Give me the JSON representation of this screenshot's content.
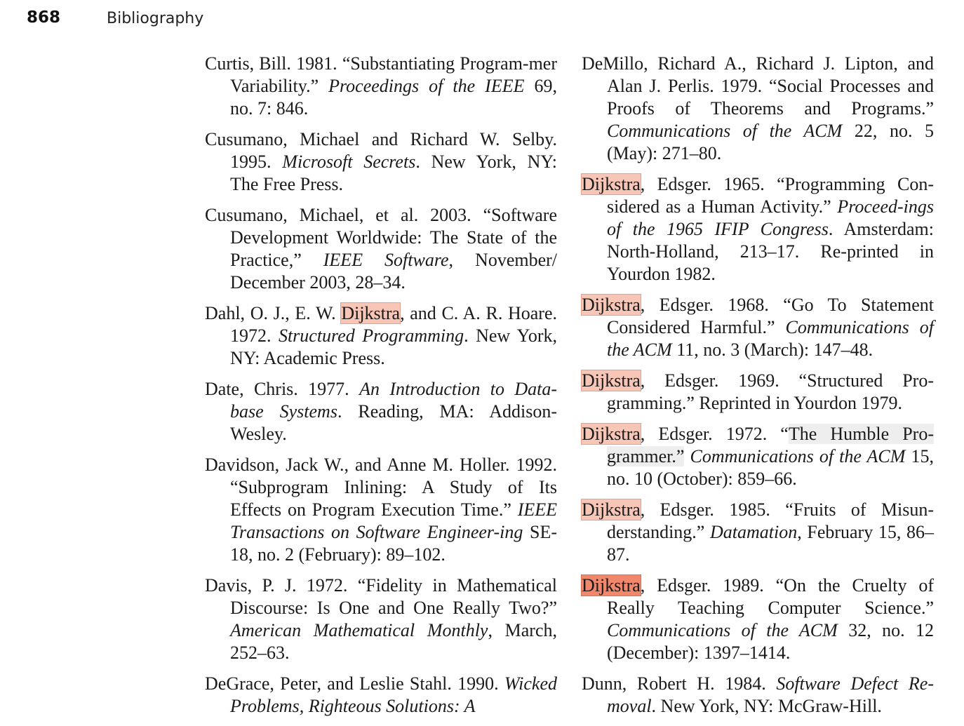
{
  "header": {
    "page_number": "868",
    "running_head": "Bibliography"
  },
  "search": {
    "highlight_term": "Dijkstra",
    "highlight_color": "#f7c6b7",
    "active_highlight_color": "#f1876b"
  },
  "columns": [
    {
      "entries": [
        {
          "segments": [
            {
              "text": "Curtis, Bill. 1981. “Substantiating Program-mer Variability.” "
            },
            {
              "text": "Proceedings of the IEEE",
              "style": "italic"
            },
            {
              "text": " 69, no. 7: 846."
            }
          ]
        },
        {
          "segments": [
            {
              "text": "Cusumano, Michael and Richard W. Selby. 1995. "
            },
            {
              "text": "Microsoft Secrets",
              "style": "italic"
            },
            {
              "text": ". New York, NY: The Free Press."
            }
          ]
        },
        {
          "segments": [
            {
              "text": "Cusumano, Michael, et al. 2003. “Software Development Worldwide: The State of the Practice,” "
            },
            {
              "text": "IEEE Software",
              "style": "italic"
            },
            {
              "text": ", November/ December 2003, 28–34."
            }
          ]
        },
        {
          "segments": [
            {
              "text": "Dahl, O. J., E. W. "
            },
            {
              "text": "Dijkstra",
              "style": "highlight"
            },
            {
              "text": ", and C. A. R. Hoare. 1972. "
            },
            {
              "text": "Structured Programming",
              "style": "italic"
            },
            {
              "text": ". New York, NY: Academic Press."
            }
          ]
        },
        {
          "segments": [
            {
              "text": "Date, Chris. 1977. "
            },
            {
              "text": "An Introduction to Data-base Systems",
              "style": "italic"
            },
            {
              "text": ". Reading, MA: Addison-Wesley."
            }
          ]
        },
        {
          "segments": [
            {
              "text": "Davidson, Jack W., and Anne M. Holler. 1992. “Subprogram Inlining: A Study of Its Effects on Program Execution Time.” "
            },
            {
              "text": "IEEE Transactions on Software Engineer-ing",
              "style": "italic"
            },
            {
              "text": " SE-18, no. 2 (February): 89–102."
            }
          ]
        },
        {
          "segments": [
            {
              "text": "Davis, P. J. 1972. “Fidelity in Mathematical Discourse: Is One and One Really Two?” "
            },
            {
              "text": "American Mathematical Monthly",
              "style": "italic"
            },
            {
              "text": ", March, 252–63."
            }
          ]
        },
        {
          "segments": [
            {
              "text": "DeGrace, Peter, and Leslie Stahl. 1990. "
            },
            {
              "text": "Wicked Problems, Righteous Solutions: A",
              "style": "italic"
            }
          ]
        }
      ]
    },
    {
      "entries": [
        {
          "segments": [
            {
              "text": "DeMillo, Richard A., Richard J. Lipton, and Alan J. Perlis. 1979. “Social Processes and Proofs of Theorems and Programs.” "
            },
            {
              "text": "Communications of the ACM",
              "style": "italic"
            },
            {
              "text": " 22, no. 5 (May): 271–80."
            }
          ]
        },
        {
          "segments": [
            {
              "text": "Dijkstra",
              "style": "highlight"
            },
            {
              "text": ", Edsger. 1965. “Programming Con-sidered as a Human Activity.” "
            },
            {
              "text": "Proceed-ings of the 1965 IFIP Congress",
              "style": "italic"
            },
            {
              "text": ". Amsterdam: North-Holland, 213–17. Re-printed in Yourdon 1982."
            }
          ]
        },
        {
          "segments": [
            {
              "text": "Dijkstra",
              "style": "highlight"
            },
            {
              "text": ", Edsger. 1968. “Go To Statement Considered Harmful.” "
            },
            {
              "text": "Communications of the ACM",
              "style": "italic"
            },
            {
              "text": " 11, no. 3 (March): 147–48."
            }
          ]
        },
        {
          "segments": [
            {
              "text": "Dijkstra",
              "style": "highlight"
            },
            {
              "text": ", Edsger. 1969. “Structured Pro-gramming.” Reprinted in Yourdon 1979."
            }
          ]
        },
        {
          "segments": [
            {
              "text": "Dijkstra",
              "style": "highlight"
            },
            {
              "text": ", Edsger. 1972. “"
            },
            {
              "text": "The Humble Pro-grammer.”",
              "style": "selected"
            },
            {
              "text": " "
            },
            {
              "text": "Communications of the ACM",
              "style": "italic"
            },
            {
              "text": " 15, no. 10 (October): 859–66."
            }
          ]
        },
        {
          "segments": [
            {
              "text": "Dijkstra",
              "style": "highlight"
            },
            {
              "text": ", Edsger. 1985. “Fruits of Misun-derstanding.” "
            },
            {
              "text": "Datamation",
              "style": "italic"
            },
            {
              "text": ", February 15, 86–87."
            }
          ]
        },
        {
          "segments": [
            {
              "text": "Dijkstra",
              "style": "highlight-active"
            },
            {
              "text": ", Edsger. 1989. “On the Cruelty of Really Teaching Computer Science.” "
            },
            {
              "text": "Communications of the ACM",
              "style": "italic"
            },
            {
              "text": " 32, no. 12 (December): 1397–1414."
            }
          ]
        },
        {
          "segments": [
            {
              "text": "Dunn, Robert H. 1984. "
            },
            {
              "text": "Software Defect Re-moval",
              "style": "italic"
            },
            {
              "text": ". New York, NY: McGraw-Hill."
            }
          ]
        }
      ]
    }
  ]
}
